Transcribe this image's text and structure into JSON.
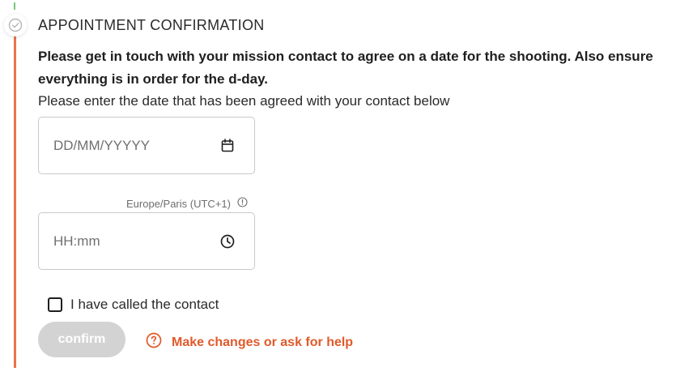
{
  "step": {
    "title": "APPOINTMENT CONFIRMATION",
    "icon": "check-circle-icon",
    "status_color": "#7bc67b",
    "timeline_color": "#e8744a"
  },
  "instructions": "Please get in touch with your mission contact to agree on a date for the shooting. Also ensure everything is in order for the d-day.",
  "subtext": "Please enter the date that has been agreed with your contact below",
  "date_field": {
    "placeholder": "DD/MM/YYYYY",
    "value": "",
    "icon": "calendar-icon"
  },
  "timezone": {
    "label": "Europe/Paris (UTC+1)",
    "icon": "info-icon"
  },
  "time_field": {
    "placeholder": "HH:mm",
    "value": "",
    "icon": "clock-icon"
  },
  "checkbox": {
    "label": "I have called the contact",
    "checked": false
  },
  "actions": {
    "confirm_label": "confirm",
    "confirm_enabled": false,
    "help_label": "Make changes or ask for help",
    "help_icon": "question-circle-icon",
    "accent_color": "#e05a2b"
  }
}
